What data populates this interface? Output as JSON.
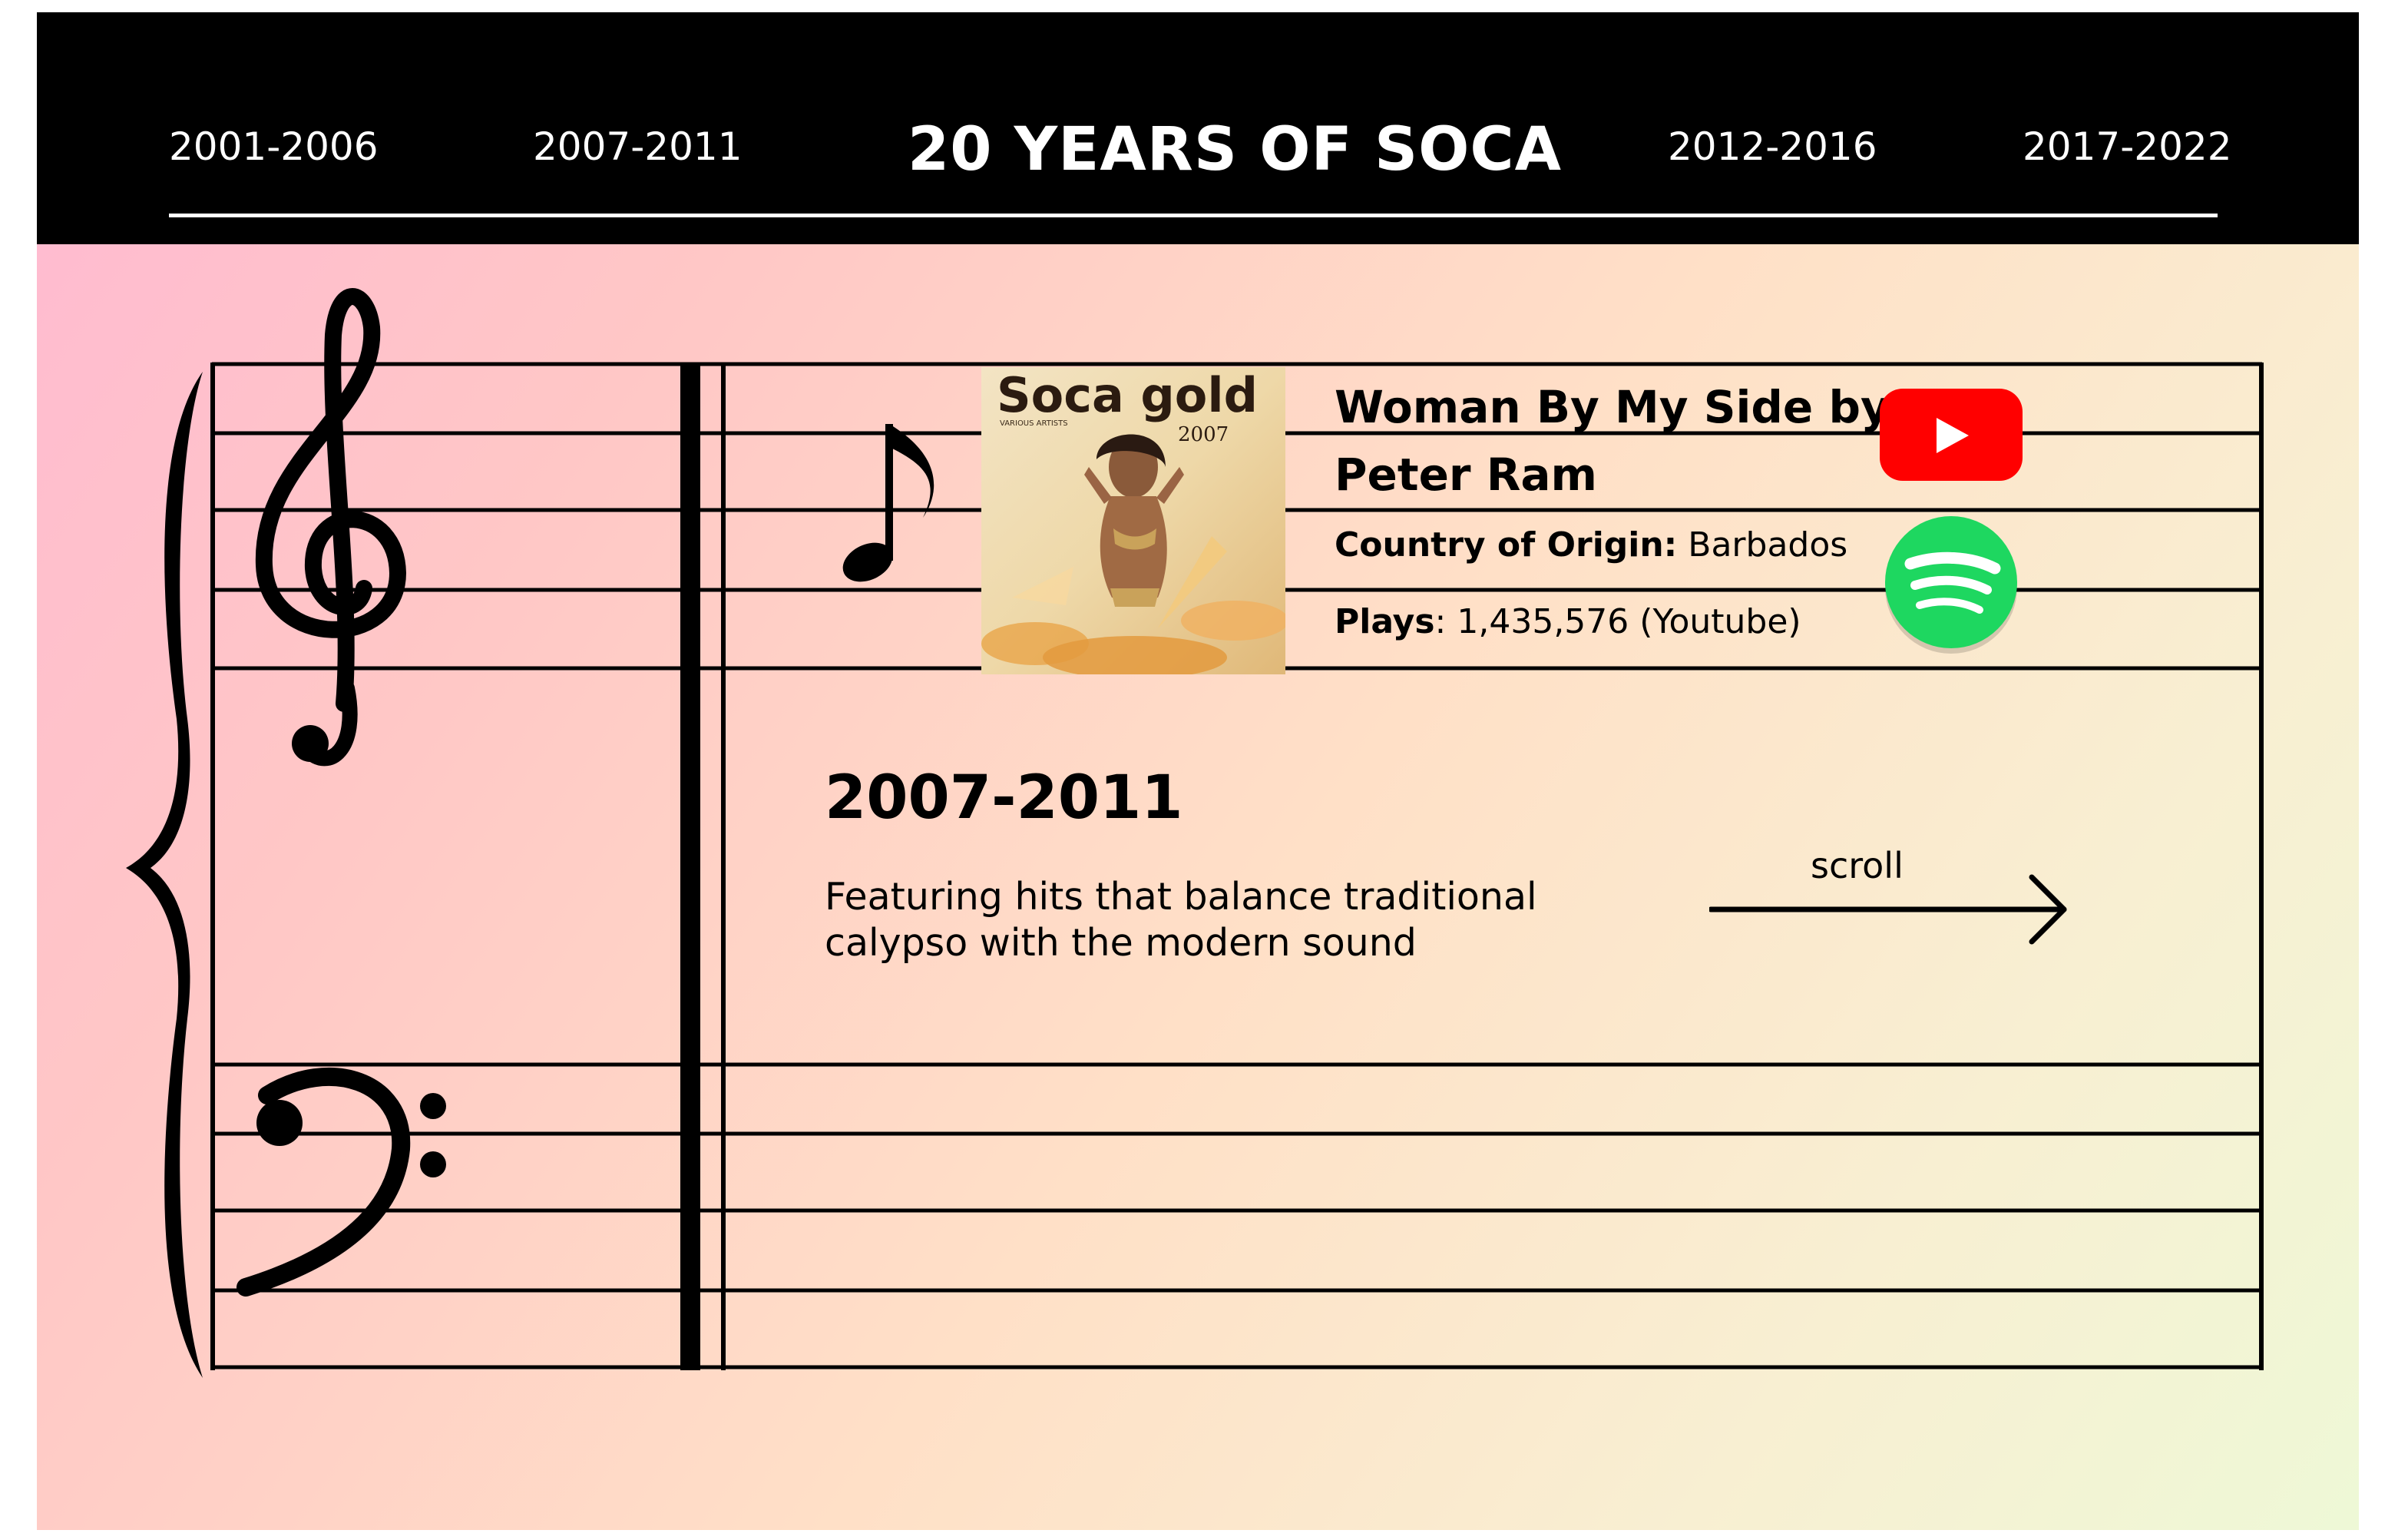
{
  "nav": {
    "link1": "2001-2006",
    "link2": "2007-2011",
    "title": "20 YEARS OF SOCA",
    "link3": "2012-2016",
    "link4": "2017-2022"
  },
  "song": {
    "title": "Woman By My Side by Peter Ram",
    "country_label": "Country of Origin:",
    "country_value": "Barbados",
    "plays_label": "Plays",
    "plays_value": ": 1,435,576 (Youtube)",
    "album": {
      "title": "Soca gold",
      "subtitle": "VARIOUS ARTISTS",
      "year": "2007"
    }
  },
  "period": {
    "heading": "2007-2011",
    "description": "Featuring hits that balance traditional calypso with the modern sound"
  },
  "scroll": {
    "label": "scroll"
  },
  "icons": {
    "youtube": "youtube-icon",
    "spotify": "spotify-icon",
    "treble_clef": "treble-clef-icon",
    "bass_clef": "bass-clef-icon",
    "note": "eighth-note-icon",
    "arrow": "arrow-right-icon"
  },
  "colors": {
    "youtube_red": "#ff0000",
    "spotify_green": "#1ed760",
    "header_bg": "#000000"
  }
}
